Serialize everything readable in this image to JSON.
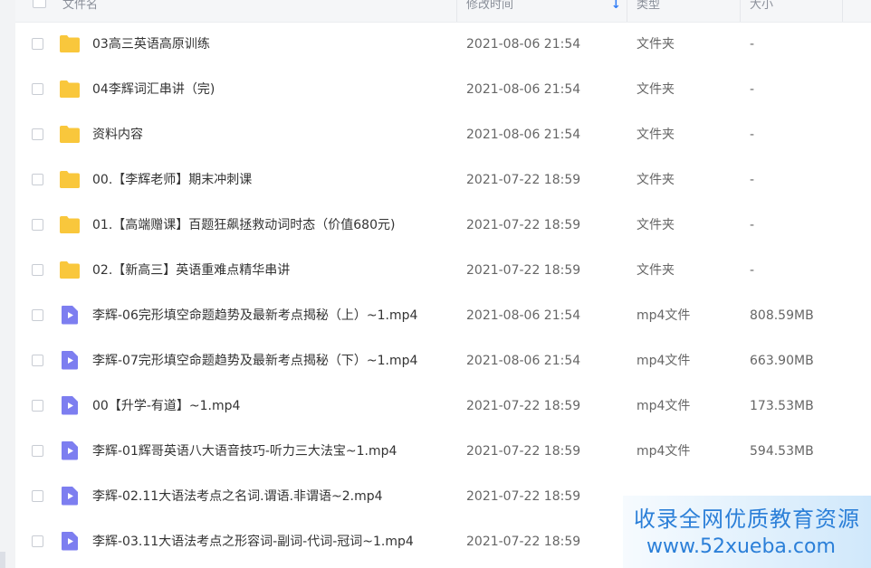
{
  "header": {
    "name_label": "文件名",
    "modified_label": "修改时间",
    "type_label": "类型",
    "size_label": "大小"
  },
  "files": [
    {
      "name": "03高三英语高原训练",
      "modified": "2021-08-06 21:54",
      "type": "文件夹",
      "size": "-",
      "icon": "folder-icon"
    },
    {
      "name": "04李辉词汇串讲（完)",
      "modified": "2021-08-06 21:54",
      "type": "文件夹",
      "size": "-",
      "icon": "folder-icon"
    },
    {
      "name": "资料内容",
      "modified": "2021-08-06 21:54",
      "type": "文件夹",
      "size": "-",
      "icon": "folder-icon"
    },
    {
      "name": "00.【李辉老师】期末冲刺课",
      "modified": "2021-07-22 18:59",
      "type": "文件夹",
      "size": "-",
      "icon": "folder-icon"
    },
    {
      "name": "01.【高端赠课】百题狂飙拯救动词时态（价值680元)",
      "modified": "2021-07-22 18:59",
      "type": "文件夹",
      "size": "-",
      "icon": "folder-icon"
    },
    {
      "name": "02.【新高三】英语重难点精华串讲",
      "modified": "2021-07-22 18:59",
      "type": "文件夹",
      "size": "-",
      "icon": "folder-icon"
    },
    {
      "name": "李辉-06完形填空命题趋势及最新考点揭秘（上）~1.mp4",
      "modified": "2021-08-06 21:54",
      "type": "mp4文件",
      "size": "808.59MB",
      "icon": "video-file-icon"
    },
    {
      "name": "李辉-07完形填空命题趋势及最新考点揭秘（下）~1.mp4",
      "modified": "2021-08-06 21:54",
      "type": "mp4文件",
      "size": "663.90MB",
      "icon": "video-file-icon"
    },
    {
      "name": "00【升学-有道】~1.mp4",
      "modified": "2021-07-22 18:59",
      "type": "mp4文件",
      "size": "173.53MB",
      "icon": "video-file-icon"
    },
    {
      "name": "李辉-01辉哥英语八大语音技巧-听力三大法宝~1.mp4",
      "modified": "2021-07-22 18:59",
      "type": "mp4文件",
      "size": "594.53MB",
      "icon": "video-file-icon"
    },
    {
      "name": "李辉-02.11大语法考点之名词.谓语.非谓语~2.mp4",
      "modified": "2021-07-22 18:59",
      "type": "",
      "size": "",
      "icon": "video-file-icon"
    },
    {
      "name": "李辉-03.11大语法考点之形容词-副词-代词-冠词~1.mp4",
      "modified": "2021-07-22 18:59",
      "type": "",
      "size": "",
      "icon": "video-file-icon"
    }
  ],
  "watermark": {
    "line1": "收录全网优质教育资源",
    "line2": "www.52xueba.com"
  },
  "colors": {
    "folder": "#f9c73c",
    "video": "#7d7ef0",
    "accent": "#2f7cf6",
    "watermark_text": "#2b7fd8"
  }
}
